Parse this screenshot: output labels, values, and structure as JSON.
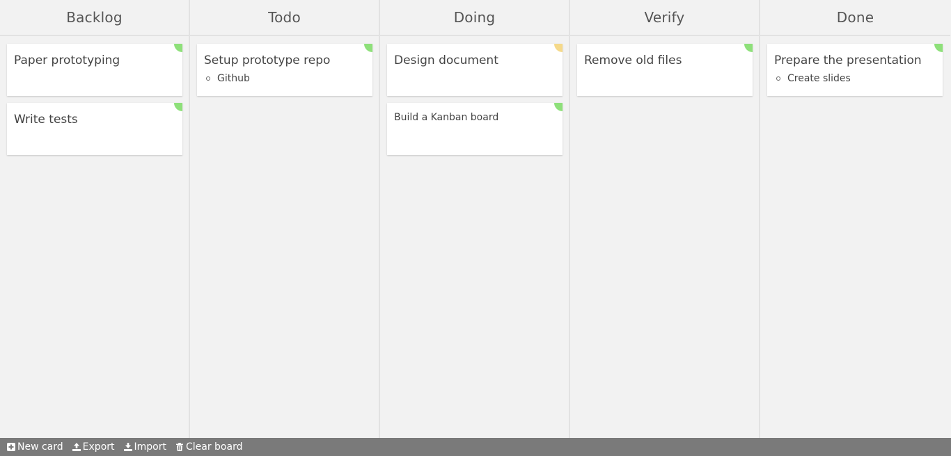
{
  "columns": [
    {
      "title": "Backlog",
      "cards": [
        {
          "title": "Paper prototyping",
          "items": [],
          "color": "#8ee07a",
          "small": false
        },
        {
          "title": "Write tests",
          "items": [],
          "color": "#8ee07a",
          "small": false
        }
      ]
    },
    {
      "title": "Todo",
      "cards": [
        {
          "title": "Setup prototype repo",
          "items": [
            "Github"
          ],
          "color": "#8ee07a",
          "small": false
        }
      ]
    },
    {
      "title": "Doing",
      "cards": [
        {
          "title": "Design document",
          "items": [],
          "color": "#f5d98a",
          "small": false
        },
        {
          "title": "Build a Kanban board",
          "items": [],
          "color": "#8ee07a",
          "small": true
        }
      ]
    },
    {
      "title": "Verify",
      "cards": [
        {
          "title": "Remove old files",
          "items": [],
          "color": "#8ee07a",
          "small": false
        }
      ]
    },
    {
      "title": "Done",
      "cards": [
        {
          "title": "Prepare the presentation",
          "items": [
            "Create slides"
          ],
          "color": "#8ee07a",
          "small": false
        }
      ]
    }
  ],
  "footer": {
    "new_card": "New card",
    "export": "Export",
    "import": "Import",
    "clear_board": "Clear board"
  }
}
